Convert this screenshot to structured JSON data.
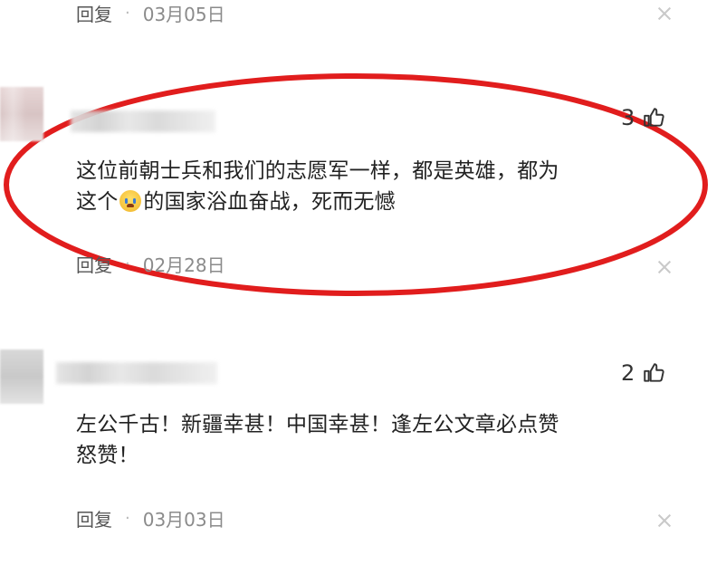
{
  "comments": [
    {
      "reply_label": "回复",
      "date": "03月05日"
    },
    {
      "likes": "3",
      "text_line1": "这位前朝士兵和我们的志愿军一样，都是英雄，都为",
      "text_line2_pre": "这个",
      "emoji": "crying-face",
      "text_line2_post": "的国家浴血奋战，死而无憾",
      "reply_label": "回复",
      "date": "02月28日"
    },
    {
      "likes": "2",
      "text_line1": "左公千古！新疆幸甚！中国幸甚！逢左公文章必点赞",
      "text_line2": "怒赞！",
      "reply_label": "回复",
      "date": "03月03日"
    }
  ],
  "icons": {
    "like": "thumbs-up-icon",
    "close": "close-icon",
    "emoji": "crying-face-emoji"
  },
  "colors": {
    "highlight_ellipse": "#e11d1d",
    "text": "#222222",
    "date": "#8b8b8b"
  }
}
